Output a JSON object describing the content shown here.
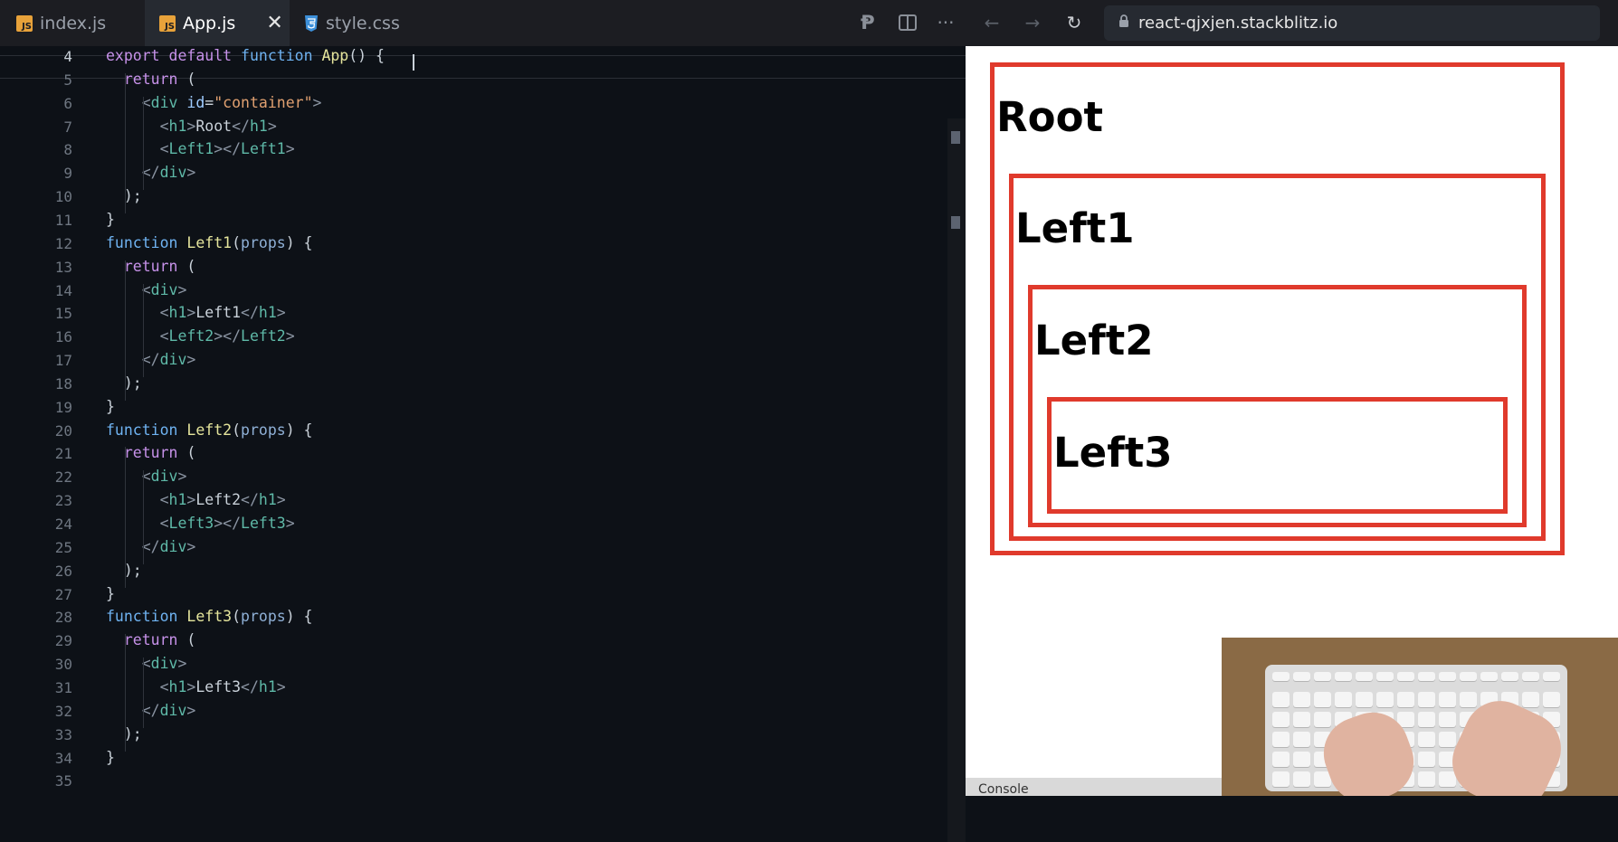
{
  "tabs": [
    {
      "label": "index.js",
      "icon": "js-file-icon"
    },
    {
      "label": "App.js",
      "icon": "js-file-icon",
      "active": true
    },
    {
      "label": "style.css",
      "icon": "css-file-icon"
    }
  ],
  "browser": {
    "url": "react-qjxjen.stackblitz.io",
    "headings": [
      "Root",
      "Left1",
      "Left2",
      "Left3"
    ],
    "console_label": "Console"
  },
  "editor": {
    "lines": [
      {
        "n": "4",
        "tokens": [
          [
            "export ",
            "kw"
          ],
          [
            "default ",
            "kw"
          ],
          [
            "function ",
            "kb"
          ],
          [
            "App",
            "fn"
          ],
          [
            "() {",
            ""
          ]
        ]
      },
      {
        "n": "5",
        "tokens": [
          [
            "  return ",
            "kw"
          ],
          [
            "(",
            ""
          ]
        ]
      },
      {
        "n": "6",
        "tokens": [
          [
            "    <",
            "tg"
          ],
          [
            "div ",
            "tn"
          ],
          [
            "id",
            "at"
          ],
          [
            "=",
            ""
          ],
          [
            "\"container\"",
            "st"
          ],
          [
            ">",
            "tg"
          ]
        ]
      },
      {
        "n": "7",
        "tokens": [
          [
            "      <",
            "tg"
          ],
          [
            "h1",
            "tn"
          ],
          [
            ">",
            "tg"
          ],
          [
            "Root",
            ""
          ],
          [
            "</",
            "tg"
          ],
          [
            "h1",
            "tn"
          ],
          [
            ">",
            "tg"
          ]
        ]
      },
      {
        "n": "8",
        "tokens": [
          [
            "      <",
            "tg"
          ],
          [
            "Left1",
            "tn"
          ],
          [
            "></",
            "tg"
          ],
          [
            "Left1",
            "tn"
          ],
          [
            ">",
            "tg"
          ]
        ]
      },
      {
        "n": "9",
        "tokens": [
          [
            "    </",
            "tg"
          ],
          [
            "div",
            "tn"
          ],
          [
            ">",
            "tg"
          ]
        ]
      },
      {
        "n": "10",
        "tokens": [
          [
            "  );",
            ""
          ]
        ]
      },
      {
        "n": "11",
        "tokens": [
          [
            "}",
            ""
          ]
        ]
      },
      {
        "n": "12",
        "tokens": [
          [
            "function ",
            "kb"
          ],
          [
            "Left1",
            "fn"
          ],
          [
            "(",
            ""
          ],
          [
            "props",
            "pm"
          ],
          [
            ") {",
            ""
          ]
        ]
      },
      {
        "n": "13",
        "tokens": [
          [
            "  return ",
            "kw"
          ],
          [
            "(",
            ""
          ]
        ]
      },
      {
        "n": "14",
        "tokens": [
          [
            "    <",
            "tg"
          ],
          [
            "div",
            "tn"
          ],
          [
            ">",
            "tg"
          ]
        ]
      },
      {
        "n": "15",
        "tokens": [
          [
            "      <",
            "tg"
          ],
          [
            "h1",
            "tn"
          ],
          [
            ">",
            "tg"
          ],
          [
            "Left1",
            ""
          ],
          [
            "</",
            "tg"
          ],
          [
            "h1",
            "tn"
          ],
          [
            ">",
            "tg"
          ]
        ]
      },
      {
        "n": "16",
        "tokens": [
          [
            "      <",
            "tg"
          ],
          [
            "Left2",
            "tn"
          ],
          [
            "></",
            "tg"
          ],
          [
            "Left2",
            "tn"
          ],
          [
            ">",
            "tg"
          ]
        ]
      },
      {
        "n": "17",
        "tokens": [
          [
            "    </",
            "tg"
          ],
          [
            "div",
            "tn"
          ],
          [
            ">",
            "tg"
          ]
        ]
      },
      {
        "n": "18",
        "tokens": [
          [
            "  );",
            ""
          ]
        ]
      },
      {
        "n": "19",
        "tokens": [
          [
            "}",
            ""
          ]
        ]
      },
      {
        "n": "20",
        "tokens": [
          [
            "function ",
            "kb"
          ],
          [
            "Left2",
            "fn"
          ],
          [
            "(",
            ""
          ],
          [
            "props",
            "pm"
          ],
          [
            ") {",
            ""
          ]
        ]
      },
      {
        "n": "21",
        "tokens": [
          [
            "  return ",
            "kw"
          ],
          [
            "(",
            ""
          ]
        ]
      },
      {
        "n": "22",
        "tokens": [
          [
            "    <",
            "tg"
          ],
          [
            "div",
            "tn"
          ],
          [
            ">",
            "tg"
          ]
        ]
      },
      {
        "n": "23",
        "tokens": [
          [
            "      <",
            "tg"
          ],
          [
            "h1",
            "tn"
          ],
          [
            ">",
            "tg"
          ],
          [
            "Left2",
            ""
          ],
          [
            "</",
            "tg"
          ],
          [
            "h1",
            "tn"
          ],
          [
            ">",
            "tg"
          ]
        ]
      },
      {
        "n": "24",
        "tokens": [
          [
            "      <",
            "tg"
          ],
          [
            "Left3",
            "tn"
          ],
          [
            "></",
            "tg"
          ],
          [
            "Left3",
            "tn"
          ],
          [
            ">",
            "tg"
          ]
        ]
      },
      {
        "n": "25",
        "tokens": [
          [
            "    </",
            "tg"
          ],
          [
            "div",
            "tn"
          ],
          [
            ">",
            "tg"
          ]
        ]
      },
      {
        "n": "26",
        "tokens": [
          [
            "  );",
            ""
          ]
        ]
      },
      {
        "n": "27",
        "tokens": [
          [
            "}",
            ""
          ]
        ]
      },
      {
        "n": "28",
        "tokens": [
          [
            "function ",
            "kb"
          ],
          [
            "Left3",
            "fn"
          ],
          [
            "(",
            ""
          ],
          [
            "props",
            "pm"
          ],
          [
            ") {",
            ""
          ]
        ]
      },
      {
        "n": "29",
        "tokens": [
          [
            "  return ",
            "kw"
          ],
          [
            "(",
            ""
          ]
        ]
      },
      {
        "n": "30",
        "tokens": [
          [
            "    <",
            "tg"
          ],
          [
            "div",
            "tn"
          ],
          [
            ">",
            "tg"
          ]
        ]
      },
      {
        "n": "31",
        "tokens": [
          [
            "      <",
            "tg"
          ],
          [
            "h1",
            "tn"
          ],
          [
            ">",
            "tg"
          ],
          [
            "Left3",
            ""
          ],
          [
            "</",
            "tg"
          ],
          [
            "h1",
            "tn"
          ],
          [
            ">",
            "tg"
          ]
        ]
      },
      {
        "n": "32",
        "tokens": [
          [
            "    </",
            "tg"
          ],
          [
            "div",
            "tn"
          ],
          [
            ">",
            "tg"
          ]
        ]
      },
      {
        "n": "33",
        "tokens": [
          [
            "  );",
            ""
          ]
        ]
      },
      {
        "n": "34",
        "tokens": [
          [
            "}",
            ""
          ]
        ]
      },
      {
        "n": "35",
        "tokens": []
      }
    ]
  },
  "colors": {
    "accent_red": "#e03a2c",
    "editor_bg": "#0d1117",
    "tab_bar": "#1c1d22"
  }
}
